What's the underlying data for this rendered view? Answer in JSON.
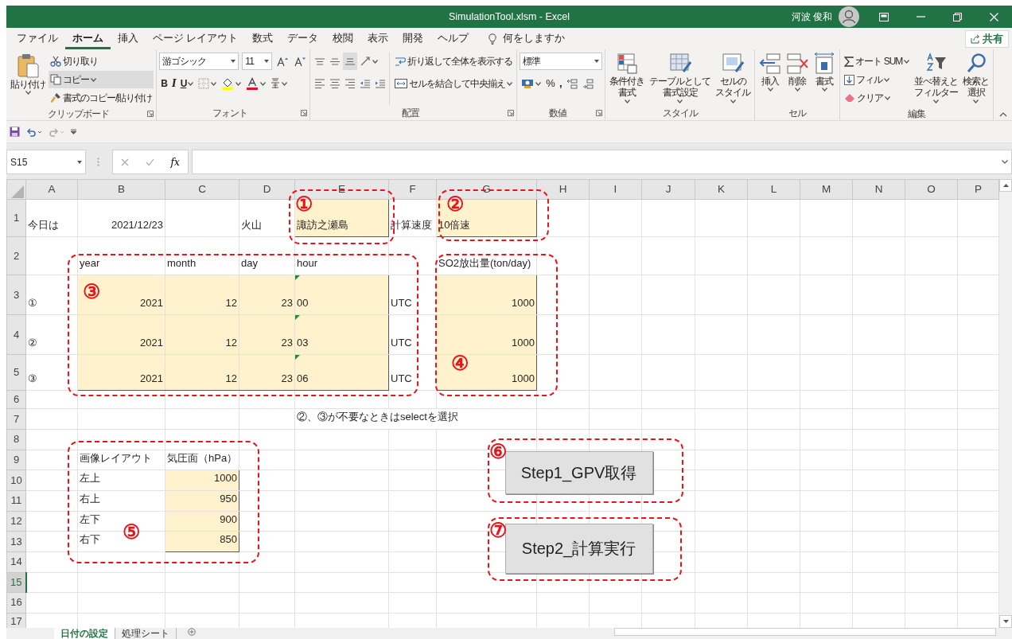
{
  "window": {
    "title": "SimulationTool.xlsm  -  Excel",
    "user": "河波 俊和"
  },
  "menu_tabs": [
    {
      "label": "ファイル",
      "selected": false
    },
    {
      "label": "ホーム",
      "selected": true
    },
    {
      "label": "挿入",
      "selected": false
    },
    {
      "label": "ページ レイアウト",
      "selected": false
    },
    {
      "label": "数式",
      "selected": false
    },
    {
      "label": "データ",
      "selected": false
    },
    {
      "label": "校閲",
      "selected": false
    },
    {
      "label": "表示",
      "selected": false
    },
    {
      "label": "開発",
      "selected": false
    },
    {
      "label": "ヘルプ",
      "selected": false
    }
  ],
  "search_hint": "何をしますか",
  "share_button": "共有",
  "ribbon": {
    "clipboard": {
      "label": "クリップボード",
      "paste": "貼り付け",
      "cut": "切り取り",
      "copy": "コピー",
      "format_painter": "書式のコピー/貼り付け"
    },
    "font": {
      "label": "フォント",
      "font_name": "游ゴシック",
      "font_size": "11",
      "bold": "B",
      "italic": "I",
      "underline": "U"
    },
    "alignment": {
      "label": "配置",
      "wrap_text": "折り返して全体を表示する",
      "merge_center": "セルを結合して中央揃え"
    },
    "number": {
      "label": "数値",
      "format": "標準",
      "percent": "%",
      "comma": ","
    },
    "styles": {
      "label": "スタイル",
      "buttons": [
        {
          "kind": "conditional",
          "lines": [
            "条件付き",
            "書式"
          ]
        },
        {
          "kind": "table",
          "lines": [
            "テーブルとして",
            "書式設定"
          ]
        },
        {
          "kind": "cellstyle",
          "lines": [
            "セルの",
            "スタイル"
          ]
        }
      ]
    },
    "cells": {
      "label": "セル",
      "buttons": [
        {
          "kind": "insert",
          "lines": [
            "挿入"
          ]
        },
        {
          "kind": "delete",
          "lines": [
            "削除"
          ]
        },
        {
          "kind": "format",
          "lines": [
            "書式"
          ]
        }
      ]
    },
    "editing": {
      "label": "編集",
      "autosum": "オート SUM",
      "fill": "フィル",
      "clear": "クリア",
      "buttons": [
        {
          "kind": "sort",
          "lines": [
            "並べ替えと",
            "フィルター"
          ]
        },
        {
          "kind": "find",
          "lines": [
            "検索と",
            "選択"
          ]
        }
      ]
    }
  },
  "formula_bar": {
    "name_box": "S15",
    "function_label": "fx"
  },
  "columns": [
    "A",
    "B",
    "C",
    "D",
    "E",
    "F",
    "G",
    "H",
    "I",
    "J",
    "K",
    "L",
    "M",
    "N",
    "O",
    "P"
  ],
  "rows": [
    {
      "header": "1",
      "selected": false,
      "cells": {
        "A": {
          "text": "今日は",
          "kind": "text",
          "filled": false
        },
        "B": {
          "text": "2021/12/23",
          "kind": "number",
          "filled": false
        },
        "D": {
          "text": "火山",
          "kind": "text",
          "filled": false
        },
        "E": {
          "text": "諏訪之瀬島",
          "kind": "text",
          "filled": true
        },
        "F": {
          "text": "計算速度",
          "kind": "text",
          "filled": false
        },
        "G": {
          "text": "10倍速",
          "kind": "text",
          "filled": true
        }
      }
    },
    {
      "header": "2",
      "selected": false,
      "cells": {
        "B": {
          "text": "year",
          "kind": "text",
          "filled": false
        },
        "C": {
          "text": "month",
          "kind": "text",
          "filled": false
        },
        "D": {
          "text": "day",
          "kind": "text",
          "filled": false
        },
        "E": {
          "text": "hour",
          "kind": "text",
          "filled": false
        },
        "G": {
          "text": "SO2放出量(ton/day)",
          "kind": "text",
          "filled": false
        }
      }
    },
    {
      "header": "3",
      "selected": false,
      "cells": {
        "A": {
          "text": "①",
          "kind": "text",
          "filled": false
        },
        "B": {
          "text": "2021",
          "kind": "number",
          "filled": true
        },
        "C": {
          "text": "12",
          "kind": "number",
          "filled": true
        },
        "D": {
          "text": "23",
          "kind": "number",
          "filled": true
        },
        "E": {
          "text": "00",
          "kind": "number_as_text",
          "filled": true
        },
        "F": {
          "text": "UTC",
          "kind": "text",
          "filled": false
        },
        "G": {
          "text": "1000",
          "kind": "number",
          "filled": true
        }
      }
    },
    {
      "header": "4",
      "selected": false,
      "cells": {
        "A": {
          "text": "②",
          "kind": "text",
          "filled": false
        },
        "B": {
          "text": "2021",
          "kind": "number",
          "filled": true
        },
        "C": {
          "text": "12",
          "kind": "number",
          "filled": true
        },
        "D": {
          "text": "23",
          "kind": "number",
          "filled": true
        },
        "E": {
          "text": "03",
          "kind": "number_as_text",
          "filled": true
        },
        "F": {
          "text": "UTC",
          "kind": "text",
          "filled": false
        },
        "G": {
          "text": "1000",
          "kind": "number",
          "filled": true
        }
      }
    },
    {
      "header": "5",
      "selected": false,
      "cells": {
        "A": {
          "text": "③",
          "kind": "text",
          "filled": false
        },
        "B": {
          "text": "2021",
          "kind": "number",
          "filled": true
        },
        "C": {
          "text": "12",
          "kind": "number",
          "filled": true
        },
        "D": {
          "text": "23",
          "kind": "number",
          "filled": true
        },
        "E": {
          "text": "06",
          "kind": "number_as_text",
          "filled": true
        },
        "F": {
          "text": "UTC",
          "kind": "text",
          "filled": false
        },
        "G": {
          "text": "1000",
          "kind": "number",
          "filled": true
        }
      }
    },
    {
      "header": "6",
      "selected": false,
      "cells": {}
    },
    {
      "header": "7",
      "selected": false,
      "cells": {
        "E": {
          "text": "②、③が不要なときはselectを選択",
          "kind": "text",
          "filled": false
        }
      }
    },
    {
      "header": "8",
      "selected": false,
      "cells": {}
    },
    {
      "header": "9",
      "selected": false,
      "cells": {
        "B": {
          "text": "画像レイアウト",
          "kind": "text",
          "filled": false
        },
        "C": {
          "text": "気圧面（hPa）",
          "kind": "text",
          "filled": false
        }
      }
    },
    {
      "header": "10",
      "selected": false,
      "cells": {
        "B": {
          "text": "左上",
          "kind": "text",
          "filled": false
        },
        "C": {
          "text": "1000",
          "kind": "number",
          "filled": true
        }
      }
    },
    {
      "header": "11",
      "selected": false,
      "cells": {
        "B": {
          "text": "右上",
          "kind": "text",
          "filled": false
        },
        "C": {
          "text": "950",
          "kind": "number",
          "filled": true
        }
      }
    },
    {
      "header": "12",
      "selected": false,
      "cells": {
        "B": {
          "text": "左下",
          "kind": "text",
          "filled": false
        },
        "C": {
          "text": "900",
          "kind": "number",
          "filled": true
        }
      }
    },
    {
      "header": "13",
      "selected": false,
      "cells": {
        "B": {
          "text": "右下",
          "kind": "text",
          "filled": false
        },
        "C": {
          "text": "850",
          "kind": "number",
          "filled": true
        }
      }
    },
    {
      "header": "14",
      "selected": false,
      "cells": {}
    },
    {
      "header": "15",
      "selected": true,
      "cells": {}
    },
    {
      "header": "16",
      "selected": false,
      "cells": {}
    },
    {
      "header": "17",
      "selected": false,
      "cells": {}
    }
  ],
  "annotations": [
    {
      "number": "①"
    },
    {
      "number": "②"
    },
    {
      "number": "③"
    },
    {
      "number": "④"
    },
    {
      "number": "⑤"
    }
  ],
  "macro_buttons": [
    {
      "number": "⑥",
      "label": "Step1_GPV取得"
    },
    {
      "number": "⑦",
      "label": "Step2_計算実行"
    }
  ],
  "sheet_tabs": [
    {
      "label": "日付の設定",
      "selected": true
    },
    {
      "label": "処理シート",
      "selected": false
    }
  ]
}
